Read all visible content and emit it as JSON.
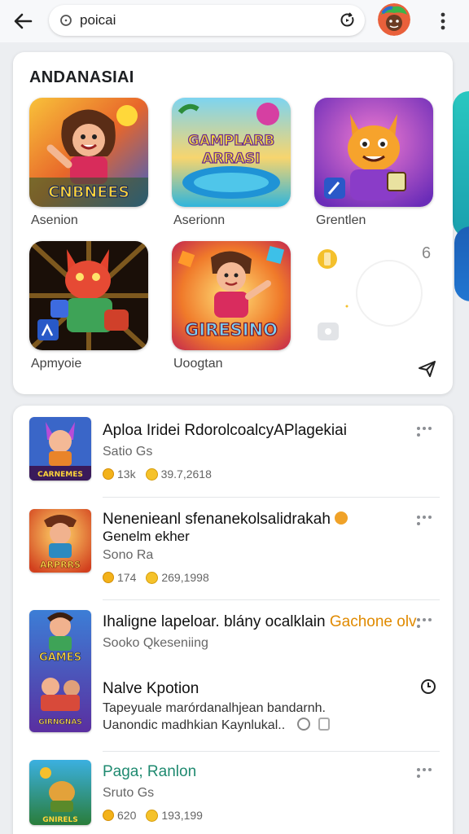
{
  "search": {
    "value": "poicai"
  },
  "colors": {
    "teal": "#29c7c0",
    "blue": "#1d5fb6",
    "accent_orange": "#e08a00",
    "green_title": "#1f8a70"
  },
  "grid": {
    "title": "ANDANASIAI",
    "apps": [
      {
        "label": "Asenion",
        "icon_text": "CNBNEES"
      },
      {
        "label": "Aserionn",
        "icon_text": "GAMPLARBARRASI"
      },
      {
        "label": "Grentlen",
        "icon_text": ""
      },
      {
        "label": "Apmyoie",
        "icon_text": ""
      },
      {
        "label": "Uoogtan",
        "icon_text": "GIRESINO"
      }
    ],
    "placeholder_number": "6"
  },
  "list": {
    "rows": [
      {
        "title": "Aploa Iridei RdorolcoalcyAPlagekiai",
        "sub": "Satio Gs",
        "coins": "13k",
        "score": "39.7,2618",
        "thumb_text": "CARNEMES"
      },
      {
        "title": "Nenenieanl sfenanekolsalidrakah",
        "title2": "Genelm ekher",
        "sub": "Sono Ra",
        "coins": "174",
        "score": "269,1998",
        "thumb_text": "ARPRRS"
      },
      {
        "title": "Ihaligne lapeloar. blány ocalklain",
        "title_highlight": "Gachone olv",
        "sub": "Sooko Qkeseniing",
        "extra_title": "Nalve Kpotion",
        "desc1": "Tapeyuale marórdanalhjean bandarnh.",
        "desc2": "Uanondic madhkian Kaynlukal..",
        "thumb_text_top": "GAMES",
        "thumb_text_bottom": "GIRNGNAS"
      },
      {
        "title": "Paga; Ranlon",
        "sub": "Sruto Gs",
        "coins": "620",
        "score": "193,199",
        "thumb_text": "GNIRELS"
      }
    ]
  }
}
